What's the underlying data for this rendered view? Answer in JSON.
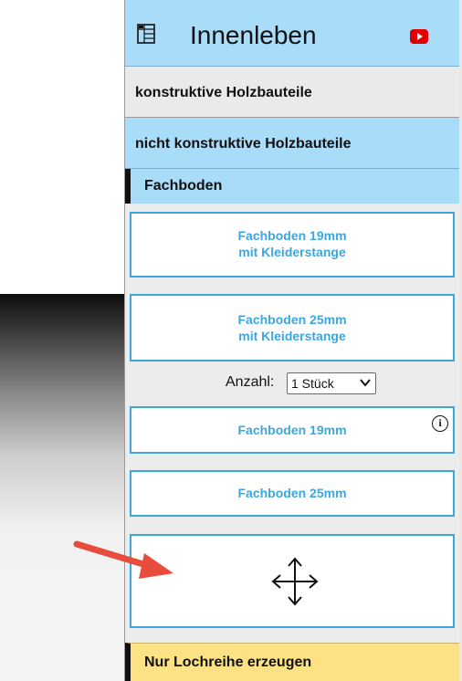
{
  "header": {
    "title": "Innenleben",
    "icon": "grid-table-icon",
    "video_icon": "youtube-icon",
    "video_color": "#e00000"
  },
  "menu": {
    "item1": "konstruktive Holzbauteile",
    "item2": "nicht konstruktive Holzbauteile"
  },
  "section": {
    "title": "Fachboden"
  },
  "buttons": {
    "b1_line1": "Fachboden 19mm",
    "b1_line2": "mit Kleiderstange",
    "b2_line1": "Fachboden 25mm",
    "b2_line2": "mit Kleiderstange",
    "b3_label": "Fachboden 19mm",
    "b4_label": "Fachboden 25mm",
    "b5_icon": "move-arrows-icon"
  },
  "quantity": {
    "label": "Anzahl:",
    "value": "1 Stück"
  },
  "info": {
    "symbol": "i"
  },
  "bottom": {
    "label": "Nur Lochreihe erzeugen"
  },
  "colors": {
    "accent": "#3ba7dc",
    "header_bg": "#a8dcf8",
    "bottom_bg": "#fde285",
    "arrow": "#e74c3c"
  }
}
